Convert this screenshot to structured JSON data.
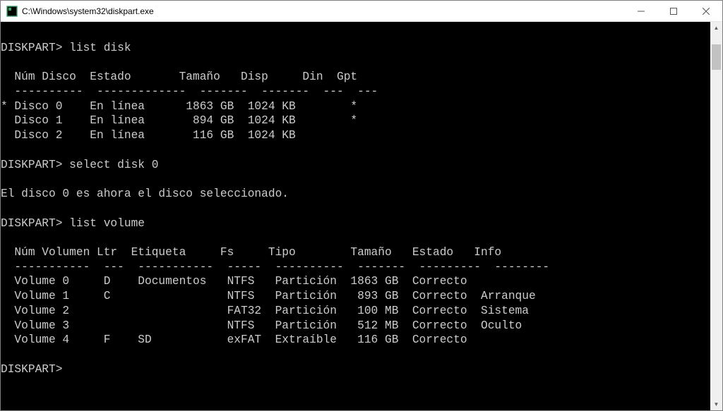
{
  "window": {
    "title": "C:\\Windows\\system32\\diskpart.exe"
  },
  "terminal": {
    "prompt": "DISKPART>",
    "commands": {
      "cmd1": "list disk",
      "cmd2": "select disk 0",
      "cmd3": "list volume"
    },
    "disk_table": {
      "headers": {
        "num": "Núm Disco",
        "status": "Estado",
        "size": "Tamaño",
        "free": "Disp",
        "dyn": "Din",
        "gpt": "Gpt"
      },
      "rows": [
        {
          "marker": "*",
          "num": "Disco 0",
          "status": "En línea",
          "size": "1863 GB",
          "free": "1024 KB",
          "dyn": "",
          "gpt": "*"
        },
        {
          "marker": "",
          "num": "Disco 1",
          "status": "En línea",
          "size": "894 GB",
          "free": "1024 KB",
          "dyn": "",
          "gpt": "*"
        },
        {
          "marker": "",
          "num": "Disco 2",
          "status": "En línea",
          "size": "116 GB",
          "free": "1024 KB",
          "dyn": "",
          "gpt": ""
        }
      ]
    },
    "select_response": "El disco 0 es ahora el disco seleccionado.",
    "volume_table": {
      "headers": {
        "num": "Núm Volumen",
        "ltr": "Ltr",
        "label": "Etiqueta",
        "fs": "Fs",
        "type": "Tipo",
        "size": "Tamaño",
        "status": "Estado",
        "info": "Info"
      },
      "rows": [
        {
          "num": "Volume 0",
          "ltr": "D",
          "label": "Documentos",
          "fs": "NTFS",
          "type": "Partición",
          "size": "1863 GB",
          "status": "Correcto",
          "info": ""
        },
        {
          "num": "Volume 1",
          "ltr": "C",
          "label": "",
          "fs": "NTFS",
          "type": "Partición",
          "size": "893 GB",
          "status": "Correcto",
          "info": "Arranque"
        },
        {
          "num": "Volume 2",
          "ltr": "",
          "label": "",
          "fs": "FAT32",
          "type": "Partición",
          "size": "100 MB",
          "status": "Correcto",
          "info": "Sistema"
        },
        {
          "num": "Volume 3",
          "ltr": "",
          "label": "",
          "fs": "NTFS",
          "type": "Partición",
          "size": "512 MB",
          "status": "Correcto",
          "info": "Oculto"
        },
        {
          "num": "Volume 4",
          "ltr": "F",
          "label": "SD",
          "fs": "exFAT",
          "type": "Extraíble",
          "size": "116 GB",
          "status": "Correcto",
          "info": ""
        }
      ]
    }
  }
}
